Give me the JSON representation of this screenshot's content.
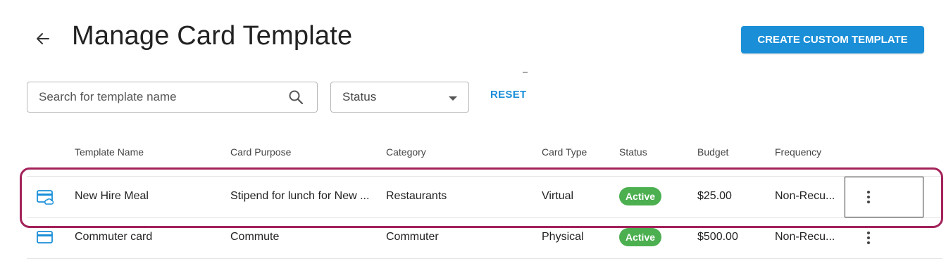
{
  "header": {
    "title": "Manage Card Template",
    "back_icon": "arrow-left-icon",
    "create_button_label": "CREATE CUSTOM TEMPLATE"
  },
  "filters": {
    "search_placeholder": "Search for template name",
    "search_value": "",
    "search_icon": "search-icon",
    "status_label": "Status",
    "reset_label": "RESET"
  },
  "table": {
    "columns": [
      "Template Name",
      "Card Purpose",
      "Category",
      "Card Type",
      "Status",
      "Budget",
      "Frequency"
    ],
    "rows": [
      {
        "icon": "virtual-card-icon",
        "template_name": "New Hire Meal",
        "card_purpose": "Stipend for lunch for New ...",
        "category": "Restaurants",
        "card_type": "Virtual",
        "status": "Active",
        "budget": "$25.00",
        "frequency": "Non-Recu..."
      },
      {
        "icon": "physical-card-icon",
        "template_name": "Commuter card",
        "card_purpose": "Commute",
        "category": "Commuter",
        "card_type": "Physical",
        "status": "Active",
        "budget": "$500.00",
        "frequency": "Non-Recu..."
      }
    ]
  },
  "colors": {
    "primary": "#1a8fd8",
    "active_badge": "#4caf50",
    "highlight_border": "#a3225a"
  }
}
